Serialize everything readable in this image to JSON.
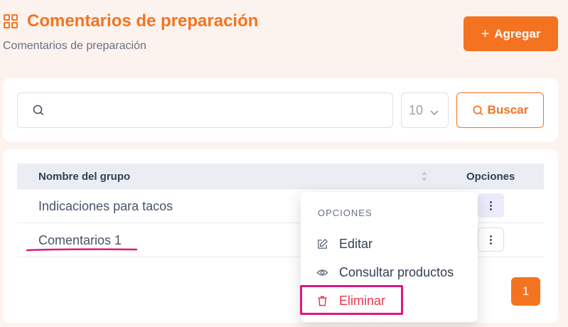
{
  "header": {
    "title": "Comentarios de preparación",
    "subtitle": "Comentarios de preparación",
    "add_label": "Agregar"
  },
  "search": {
    "placeholder": "",
    "page_size": "10",
    "button_label": "Buscar"
  },
  "table": {
    "columns": [
      "Nombre del grupo",
      "Opciones"
    ],
    "rows": [
      {
        "name": "Indicaciones para tacos"
      },
      {
        "name": "Comentarios 1"
      }
    ]
  },
  "pagination": {
    "current_page": "1"
  },
  "dropdown": {
    "heading": "OPCIONES",
    "items": [
      {
        "label": "Editar",
        "icon": "edit-icon"
      },
      {
        "label": "Consultar productos",
        "icon": "eye-icon"
      },
      {
        "label": "Eliminar",
        "icon": "trash-icon"
      }
    ]
  },
  "colors": {
    "accent": "#f47321",
    "danger": "#e5384b",
    "annotation": "#e0187e"
  }
}
